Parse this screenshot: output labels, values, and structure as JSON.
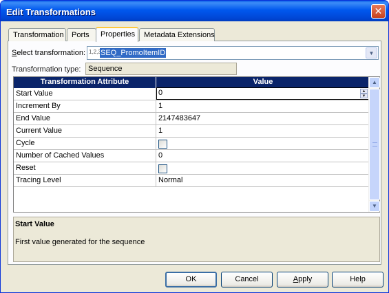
{
  "window": {
    "title": "Edit Transformations",
    "close_glyph": "✕"
  },
  "tabs": [
    {
      "label": "Transformation"
    },
    {
      "label": "Ports"
    },
    {
      "label": "Properties"
    },
    {
      "label": "Metadata Extensions"
    }
  ],
  "select_transformation": {
    "label_prefix": "S",
    "label_rest": "elect transformation:",
    "icon_glyph": "1,2,3",
    "value": "SEQ_PromoItemID"
  },
  "transformation_type": {
    "label": "Transformation type:",
    "value": "Sequence"
  },
  "grid": {
    "columns": [
      "Transformation Attribute",
      "Value"
    ],
    "rows": [
      {
        "attribute": "Start Value",
        "value": "0"
      },
      {
        "attribute": "Increment By",
        "value": "1"
      },
      {
        "attribute": "End Value",
        "value": "2147483647"
      },
      {
        "attribute": "Current Value",
        "value": "1"
      },
      {
        "attribute": "Cycle",
        "value": ""
      },
      {
        "attribute": "Number of Cached Values",
        "value": "0"
      },
      {
        "attribute": "Reset",
        "value": ""
      },
      {
        "attribute": "Tracing Level",
        "value": "Normal"
      }
    ]
  },
  "description": {
    "title": "Start Value",
    "text": "First value generated for the sequence"
  },
  "buttons": {
    "ok": "OK",
    "cancel": "Cancel",
    "apply_prefix": "A",
    "apply_rest": "pply",
    "help": "Help"
  }
}
